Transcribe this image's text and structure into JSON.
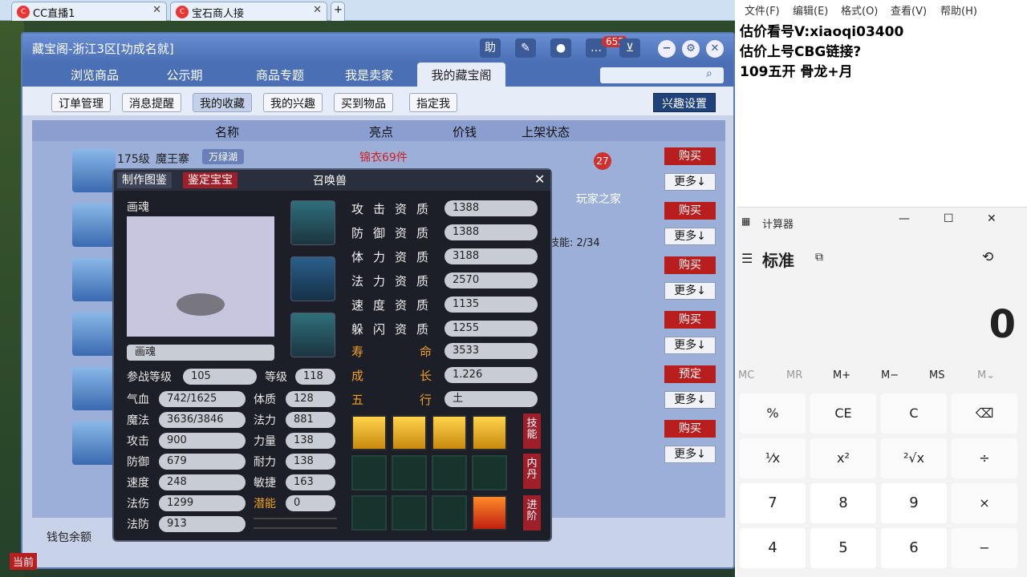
{
  "browser_tabs": [
    {
      "label": "CC直播1"
    },
    {
      "label": "宝石商人接"
    }
  ],
  "cbg": {
    "title": "藏宝阁-浙江3区[功成名就]",
    "help": "助",
    "badge": "652",
    "nav": [
      "浏览商品",
      "公示期",
      "商品专题",
      "我是卖家",
      "我的藏宝阁"
    ],
    "subnav": [
      "订单管理",
      "消息提醒",
      "我的收藏",
      "我的兴趣",
      "买到物品",
      "指定我"
    ],
    "interest_btn": "兴趣设置",
    "table_headers": {
      "name": "名称",
      "highlight": "亮点",
      "price": "价钱",
      "status": "上架状态"
    },
    "row1": {
      "level": "175级",
      "name": "魔王寨",
      "server": "万绿湖",
      "highlight": "锦衣69件",
      "count": "27"
    },
    "actions": [
      "购买",
      "购买",
      "购买",
      "购买",
      "预定",
      "购买"
    ],
    "more": "更多↓",
    "right_tab": "玩家之家",
    "skills_count": "技能: 2/34",
    "wallet": "钱包余额",
    "bottom": "当前"
  },
  "pet": {
    "tabs": {
      "atlas": "制作图鉴",
      "appraise": "鉴定宝宝"
    },
    "title": "召唤兽",
    "name": "画魂",
    "name_field": "画魂",
    "battle_level_lbl": "参战等级",
    "battle_level": "105",
    "level_lbl": "等级",
    "level": "118",
    "stats": [
      {
        "label": "气血",
        "value": "742/1625"
      },
      {
        "label": "魔法",
        "value": "3636/3846"
      },
      {
        "label": "攻击",
        "value": "900"
      },
      {
        "label": "防御",
        "value": "679"
      },
      {
        "label": "速度",
        "value": "248"
      },
      {
        "label": "法伤",
        "value": "1299"
      },
      {
        "label": "法防",
        "value": "913"
      }
    ],
    "attrs": [
      {
        "label": "体质",
        "value": "128"
      },
      {
        "label": "法力",
        "value": "881"
      },
      {
        "label": "力量",
        "value": "138"
      },
      {
        "label": "耐力",
        "value": "138"
      },
      {
        "label": "敏捷",
        "value": "163"
      },
      {
        "label": "潜能",
        "value": "0"
      }
    ],
    "quals": [
      {
        "label": "攻击资质",
        "value": "1388"
      },
      {
        "label": "防御资质",
        "value": "1388"
      },
      {
        "label": "体力资质",
        "value": "3188"
      },
      {
        "label": "法力资质",
        "value": "2570"
      },
      {
        "label": "速度资质",
        "value": "1135"
      },
      {
        "label": "躲闪资质",
        "value": "1255"
      },
      {
        "label": "寿命",
        "value": "3533"
      },
      {
        "label": "成长",
        "value": "1.226"
      },
      {
        "label": "五行",
        "value": "土"
      }
    ],
    "side_tabs": [
      "技能",
      "内丹",
      "进阶"
    ]
  },
  "notepad": {
    "menu": [
      "文件(F)",
      "编辑(E)",
      "格式(O)",
      "查看(V)",
      "帮助(H)"
    ],
    "lines": [
      "估价看号V:xiaoqi03400",
      "估价上号CBG链接?",
      "109五开 骨龙+月"
    ]
  },
  "calc": {
    "title": "计算器",
    "mode": "标准",
    "display": "0",
    "mem": [
      "MC",
      "MR",
      "M+",
      "M−",
      "MS",
      "M⌄"
    ],
    "keys": [
      "%",
      "CE",
      "C",
      "⌫",
      "¹⁄x",
      "x²",
      "²√x",
      "÷",
      "7",
      "8",
      "9",
      "×",
      "4",
      "5",
      "6",
      "−"
    ]
  }
}
